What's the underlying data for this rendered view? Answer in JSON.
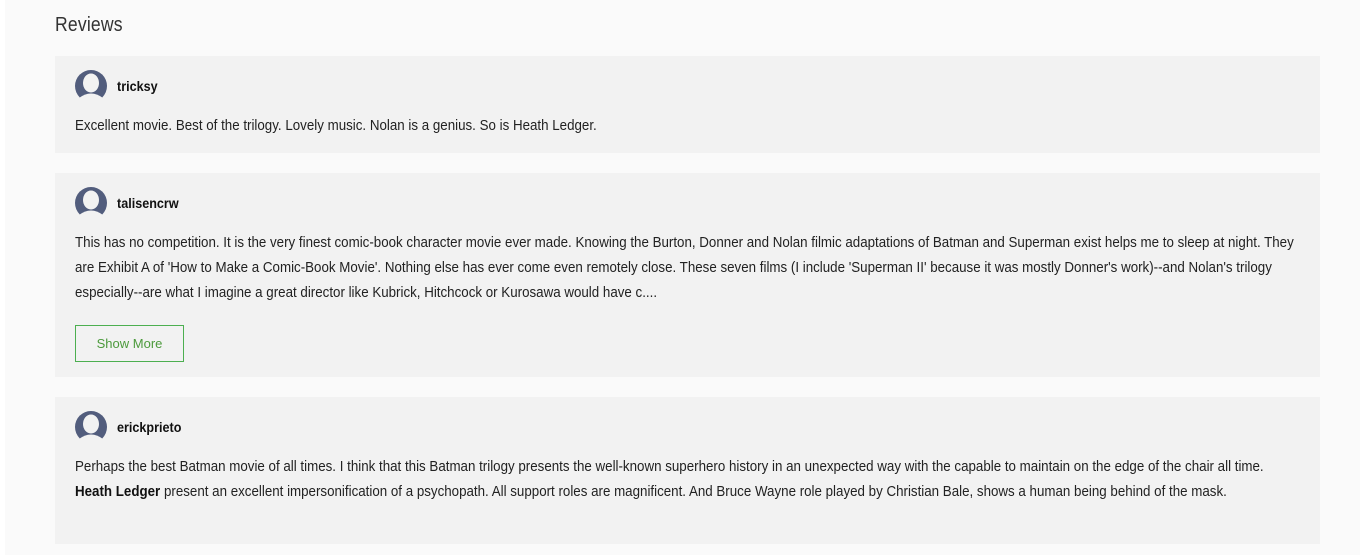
{
  "section": {
    "title": "Reviews"
  },
  "colors": {
    "avatar": "#525d7d",
    "accent": "#4caf50",
    "card_bg": "#f2f2f2"
  },
  "reviews": [
    {
      "username": "tricksy",
      "text": "Excellent movie. Best of the trilogy. Lovely music. Nolan is a genius. So is Heath Ledger."
    },
    {
      "username": "talisencrw",
      "text": "This has no competition. It is the very finest comic-book character movie ever made. Knowing the Burton, Donner and Nolan filmic adaptations of Batman and Superman exist helps me to sleep at night. They are Exhibit A of 'How to Make a Comic-Book Movie'. Nothing else has ever come even remotely close. These seven films (I include 'Superman II' because it was mostly Donner's work)--and Nolan's trilogy especially--are what I imagine a great director like Kubrick, Hitchcock or Kurosawa would have c....",
      "show_more_label": "Show More"
    },
    {
      "username": "erickprieto",
      "text_before": "Perhaps the best Batman movie of all times. I think that this Batman trilogy presents the well-known superhero history in an unexpected way with the capable to maintain on the edge of the chair all time. ",
      "text_bold": "Heath Ledger",
      "text_after": " present an excellent impersonification of a psychopath. All support roles are magnificent. And Bruce Wayne role played by Christian Bale, shows a human being behind of the mask."
    }
  ]
}
